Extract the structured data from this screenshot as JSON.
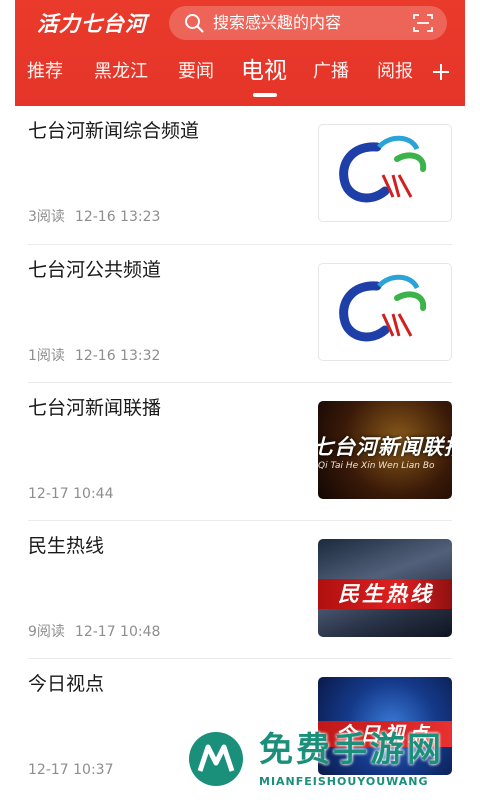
{
  "header": {
    "app_title": "活力七台河",
    "search_placeholder": "搜索感兴趣的内容",
    "tabs": [
      {
        "label": "推荐"
      },
      {
        "label": "黑龙江"
      },
      {
        "label": "要闻"
      },
      {
        "label": "电视",
        "active": true
      },
      {
        "label": "广播"
      },
      {
        "label": "阅报"
      }
    ],
    "accent_color": "#e5352a"
  },
  "feed": [
    {
      "title": "七台河新闻综合频道",
      "reads": "3阅读",
      "time": "12-16 13:23",
      "thumb": "logo"
    },
    {
      "title": "七台河公共频道",
      "reads": "1阅读",
      "time": "12-16 13:32",
      "thumb": "logo"
    },
    {
      "title": "七台河新闻联播",
      "reads": "",
      "time": "12-17 10:44",
      "thumb": "news",
      "thumb_text": "七台河新闻联播",
      "thumb_sub": "Qi Tai He Xin Wen Lian Bo"
    },
    {
      "title": "民生热线",
      "reads": "9阅读",
      "time": "12-17 10:48",
      "thumb": "hotline",
      "thumb_text": "民生热线"
    },
    {
      "title": "今日视点",
      "reads": "",
      "time": "12-17 10:37",
      "thumb": "viewpoint",
      "thumb_text": "今日视点"
    }
  ],
  "watermark": {
    "text": "免费手游网",
    "sub": "MIANFEISHOUYOUWANG"
  }
}
